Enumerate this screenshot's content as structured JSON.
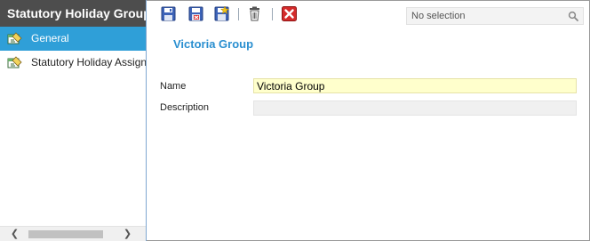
{
  "sidebar": {
    "title": "Statutory Holiday Group",
    "items": [
      {
        "label": "General",
        "icon": "general-icon",
        "active": true
      },
      {
        "label": "Statutory Holiday Assignment",
        "icon": "assignment-icon",
        "active": false
      }
    ],
    "scroll_left_glyph": "❮",
    "scroll_right_glyph": "❯"
  },
  "toolbar": {
    "buttons": [
      "save-icon",
      "save-close-icon",
      "save-new-icon",
      "delete-icon",
      "close-icon"
    ]
  },
  "search": {
    "placeholder": "No selection"
  },
  "detail": {
    "title": "Victoria Group",
    "fields": {
      "name_label": "Name",
      "name_value": "Victoria Group",
      "description_label": "Description",
      "description_value": ""
    }
  },
  "colors": {
    "header_bg": "#4d4d4d",
    "active_item_bg": "#2f9fd8",
    "title_color": "#2a8fd0",
    "name_field_bg": "#ffffcc"
  }
}
